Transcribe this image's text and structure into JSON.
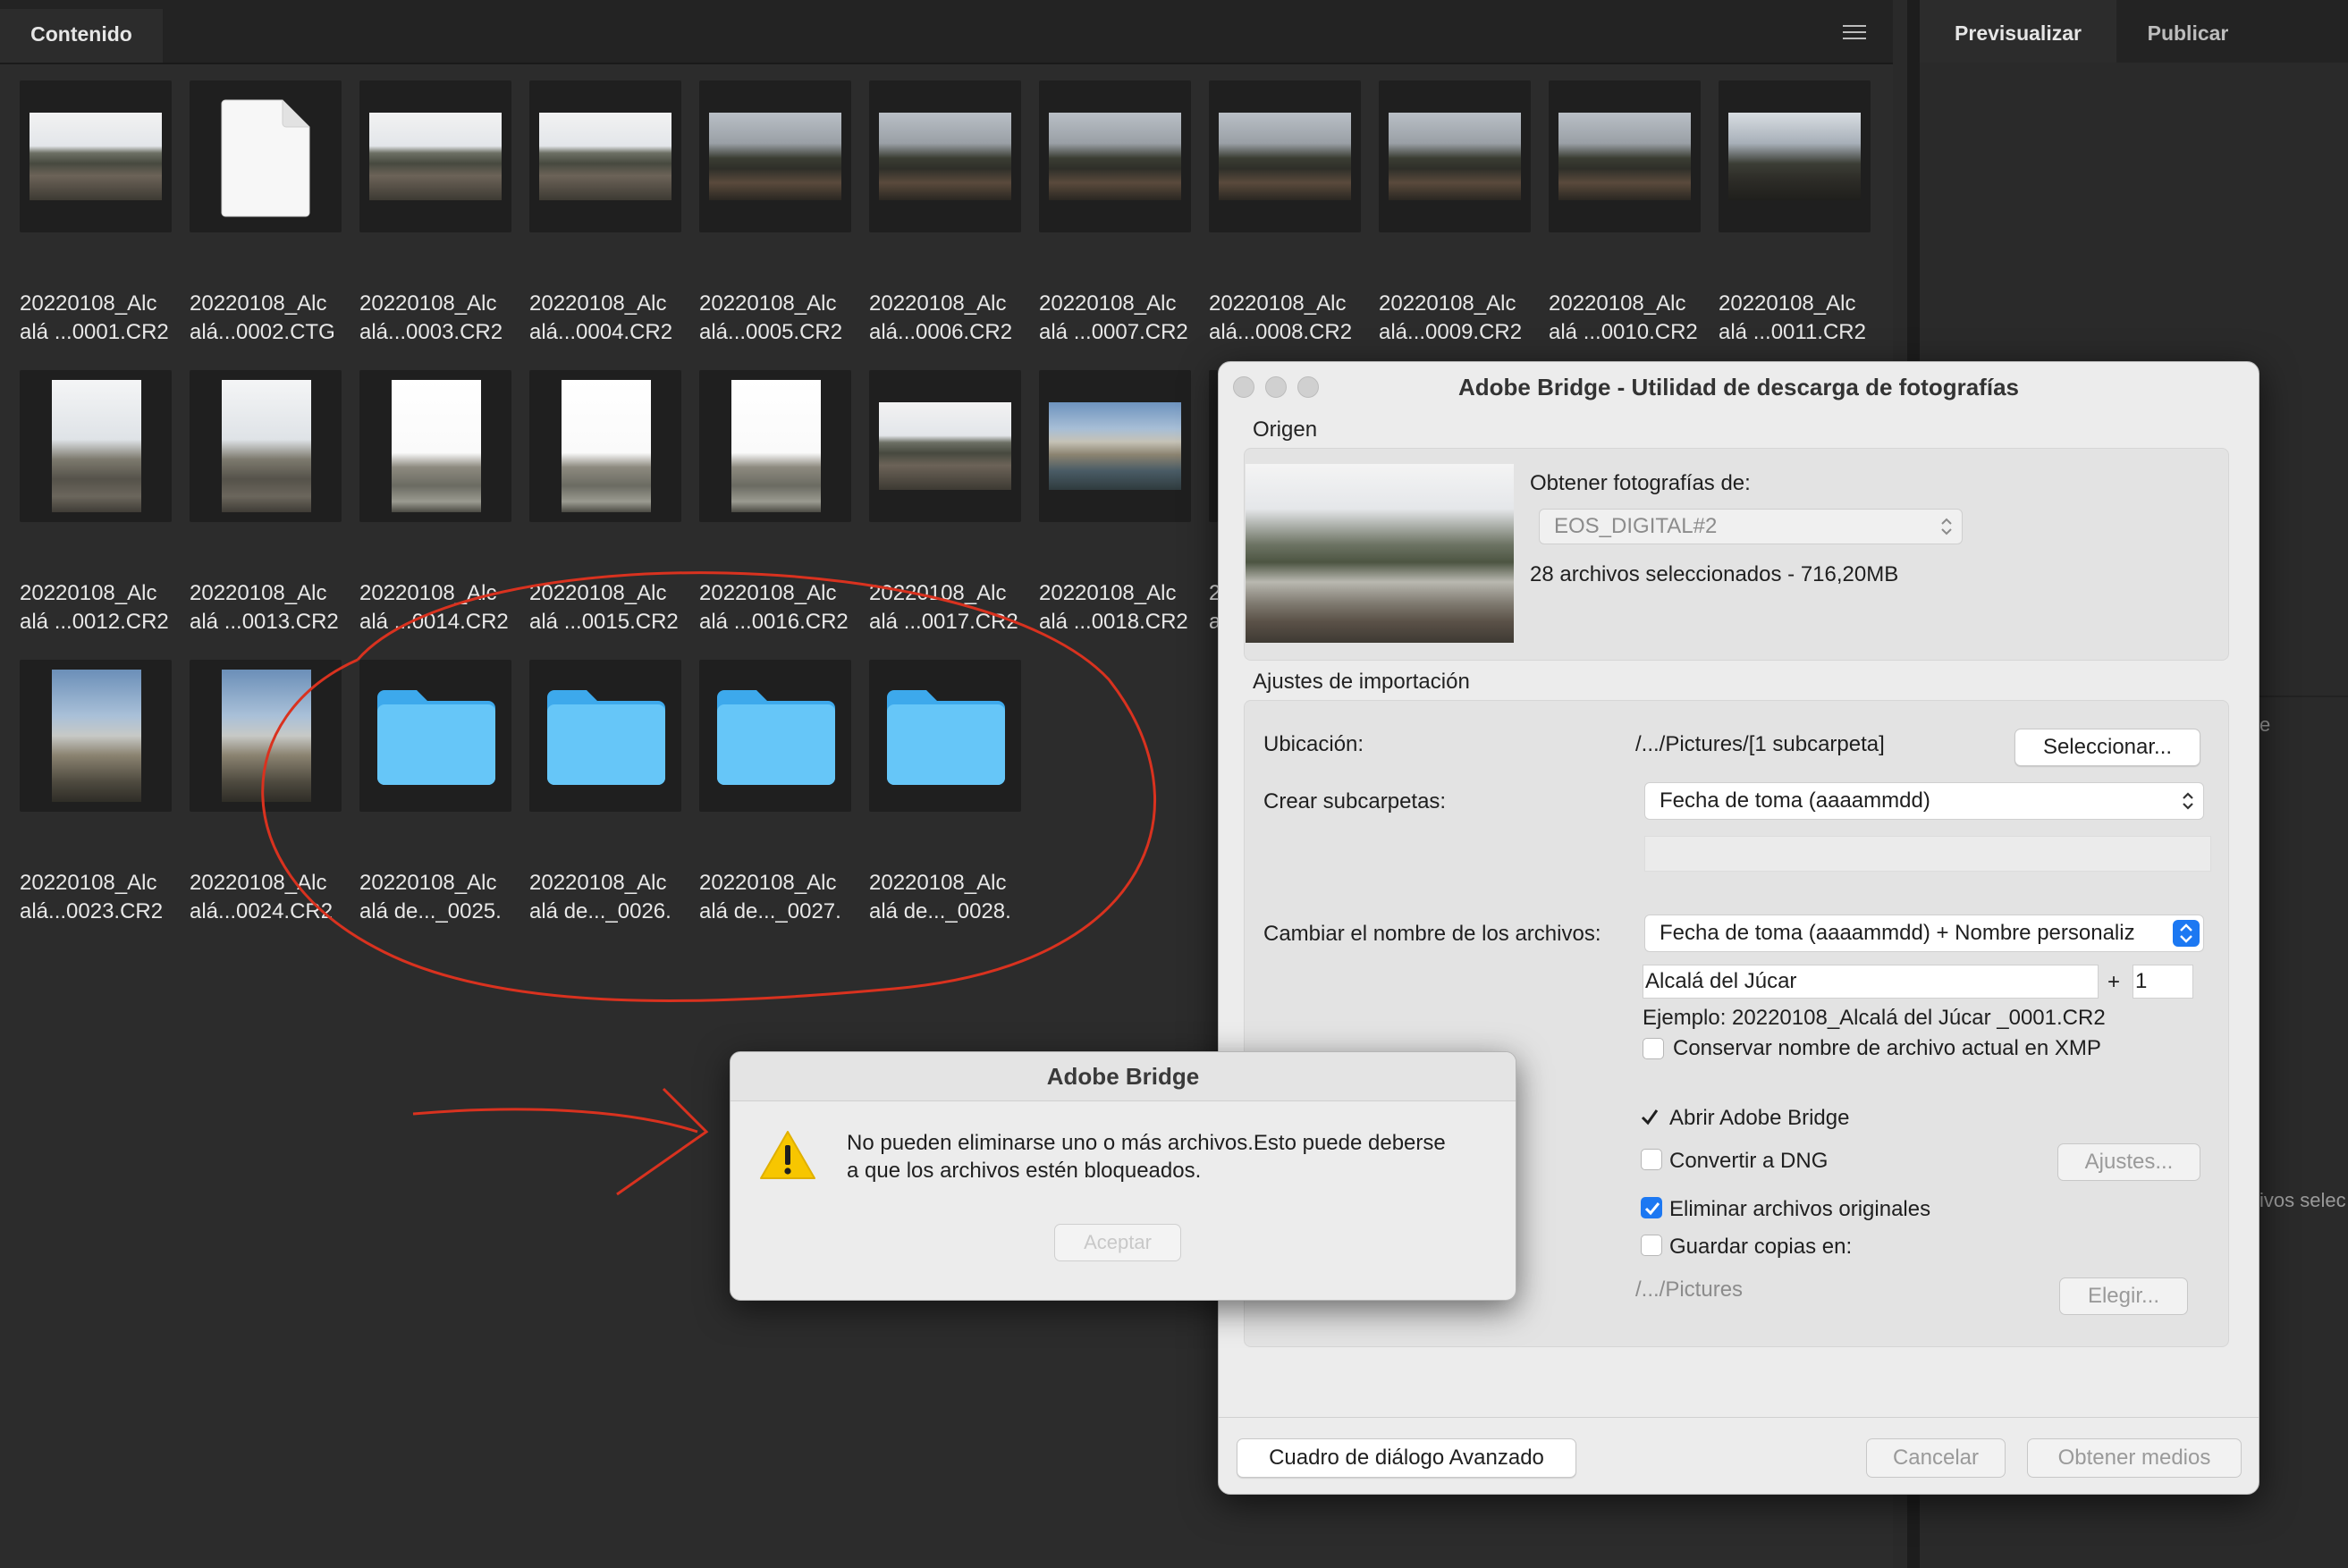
{
  "content_panel": {
    "tab_label": "Contenido",
    "menu_icon": "hamburger-menu-icon"
  },
  "right_panel": {
    "tabs": [
      "Previsualizar",
      "Publicar"
    ],
    "fragment_e": "e",
    "fragment_ivos": "ivos selec"
  },
  "files": [
    {
      "line1": "20220108_Alc",
      "line2": "alá ...0001.CR2",
      "kind": "landscape"
    },
    {
      "line1": "20220108_Alc",
      "line2": "alá...0002.CTG",
      "kind": "document"
    },
    {
      "line1": "20220108_Alc",
      "line2": "alá...0003.CR2",
      "kind": "landscape"
    },
    {
      "line1": "20220108_Alc",
      "line2": "alá...0004.CR2",
      "kind": "landscape"
    },
    {
      "line1": "20220108_Alc",
      "line2": "alá...0005.CR2",
      "kind": "landscape"
    },
    {
      "line1": "20220108_Alc",
      "line2": "alá...0006.CR2",
      "kind": "landscape"
    },
    {
      "line1": "20220108_Alc",
      "line2": "alá ...0007.CR2",
      "kind": "landscape"
    },
    {
      "line1": "20220108_Alc",
      "line2": "alá...0008.CR2",
      "kind": "landscape"
    },
    {
      "line1": "20220108_Alc",
      "line2": "alá...0009.CR2",
      "kind": "landscape"
    },
    {
      "line1": "20220108_Alc",
      "line2": "alá ...0010.CR2",
      "kind": "landscape"
    },
    {
      "line1": "20220108_Alc",
      "line2": "alá ...0011.CR2",
      "kind": "landscape"
    },
    {
      "line1": "20220108_Alc",
      "line2": "alá ...0012.CR2",
      "kind": "portrait"
    },
    {
      "line1": "20220108_Alc",
      "line2": "alá ...0013.CR2",
      "kind": "portrait"
    },
    {
      "line1": "20220108_Alc",
      "line2": "alá ...0014.CR2",
      "kind": "portrait"
    },
    {
      "line1": "20220108_Alc",
      "line2": "alá ...0015.CR2",
      "kind": "portrait"
    },
    {
      "line1": "20220108_Alc",
      "line2": "alá ...0016.CR2",
      "kind": "portrait"
    },
    {
      "line1": "20220108_Alc",
      "line2": "alá ...0017.CR2",
      "kind": "landscape"
    },
    {
      "line1": "20220108_Alc",
      "line2": "alá ...0018.CR2",
      "kind": "landscape"
    },
    {
      "line1": "2",
      "line2": "a",
      "kind": "clipped"
    },
    {
      "line1": "20220108_Alc",
      "line2": "alá...0023.CR2",
      "kind": "portrait"
    },
    {
      "line1": "20220108_Alc",
      "line2": "alá...0024.CR2",
      "kind": "portrait"
    },
    {
      "line1": "20220108_Alc",
      "line2": "alá de..._0025.",
      "kind": "folder"
    },
    {
      "line1": "20220108_Alc",
      "line2": "alá de..._0026.",
      "kind": "folder"
    },
    {
      "line1": "20220108_Alc",
      "line2": "alá de..._0027.",
      "kind": "folder"
    },
    {
      "line1": "20220108_Alc",
      "line2": "alá de..._0028.",
      "kind": "folder"
    }
  ],
  "downloader": {
    "title": "Adobe Bridge - Utilidad de descarga de fotografías",
    "origin_label": "Origen",
    "get_photos_from_label": "Obtener fotografías de:",
    "source_device": "EOS_DIGITAL#2",
    "selection_summary": "28 archivos seleccionados - 716,20MB",
    "import_settings_label": "Ajustes de importación",
    "location_label": "Ubicación:",
    "location_value": "/.../Pictures/[1 subcarpeta]",
    "select_button": "Seleccionar...",
    "subfolders_label": "Crear subcarpetas:",
    "subfolders_value": "Fecha de toma (aaaammdd)",
    "rename_label": "Cambiar el nombre de los archivos:",
    "rename_value": "Fecha de toma (aaaammdd) + Nombre personaliz",
    "custom_name_value": "Alcalá del Júcar",
    "plus_sign": "+",
    "sequence_start_value": "1",
    "example_text": "Ejemplo:  20220108_Alcalá del Júcar _0001.CR2",
    "preserve_name_label": "Conservar nombre de archivo actual en XMP",
    "open_bridge_label": "Abrir Adobe Bridge",
    "convert_dng_label": "Convertir a DNG",
    "dng_settings_button": "Ajustes...",
    "delete_originals_label": "Eliminar archivos originales",
    "save_copies_label": "Guardar copias en:",
    "copies_path": "/.../Pictures",
    "choose_button": "Elegir...",
    "advanced_button": "Cuadro de diálogo Avanzado",
    "cancel_button": "Cancelar",
    "get_media_button": "Obtener medios",
    "checkbox_states": {
      "preserve_name": false,
      "open_bridge": true,
      "convert_dng": false,
      "delete_originals": true,
      "save_copies": false
    }
  },
  "alert": {
    "title": "Adobe Bridge",
    "message_line1": "No pueden eliminarse uno o más archivos.Esto puede deberse",
    "message_line2": "a que los archivos estén bloqueados.",
    "ok_button": "Aceptar",
    "icon": "warning-icon"
  },
  "colors": {
    "accent": "#1c78f2",
    "annotation": "#d9321f",
    "folder": "#5ec3f6",
    "warning": "#f7c600"
  }
}
